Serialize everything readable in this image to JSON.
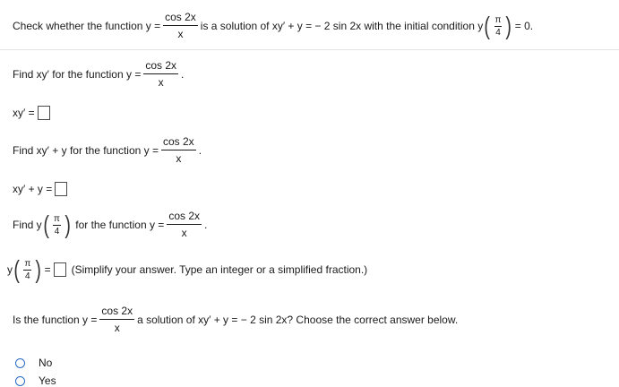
{
  "header": {
    "text_before": "Check whether the function y =",
    "numerator": "cos 2x",
    "denominator": "x",
    "text_middle": "is a solution of xy′ + y = − 2 sin 2x with the initial condition y",
    "cond_num": "π",
    "cond_den": "4",
    "text_end": "= 0."
  },
  "step1": {
    "prompt": "Find xy′ for the function y =",
    "numerator": "cos 2x",
    "denominator": "x",
    "period": ".",
    "answer_label": "xy′ ="
  },
  "step2": {
    "prompt": "Find xy′ + y for the function y =",
    "numerator": "cos 2x",
    "denominator": "x",
    "period": ".",
    "answer_label": "xy′ + y ="
  },
  "step3": {
    "prompt_start": "Find y",
    "arg_num": "π",
    "arg_den": "4",
    "prompt_mid": "for the function y =",
    "numerator": "cos 2x",
    "denominator": "x",
    "period": ".",
    "answer_lhs": "y",
    "answer_eq": "=",
    "hint": "(Simplify your answer. Type an integer or a simplified fraction.)"
  },
  "question": {
    "text_before": "Is the function y =",
    "numerator": "cos 2x",
    "denominator": "x",
    "text_after": "a solution of xy′ + y = − 2 sin 2x? Choose the correct answer below.",
    "options": [
      {
        "label": "No"
      },
      {
        "label": "Yes"
      }
    ]
  }
}
